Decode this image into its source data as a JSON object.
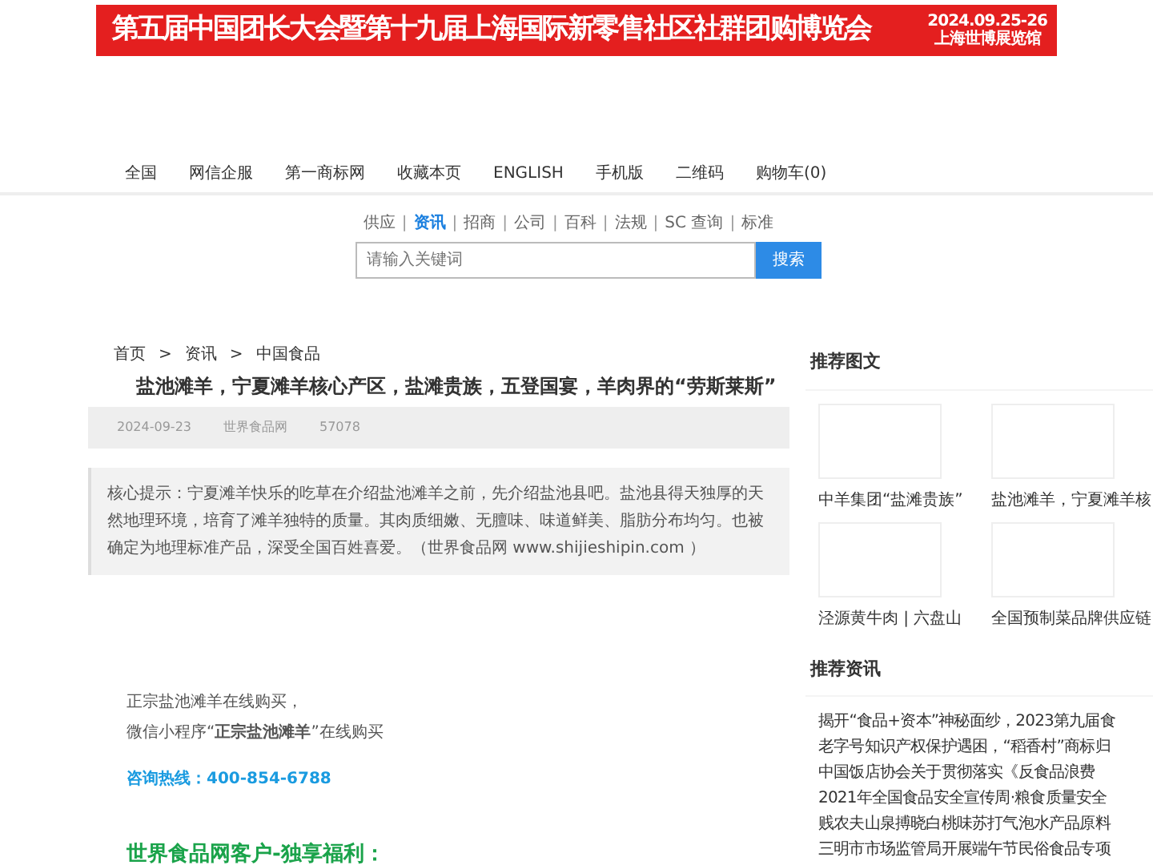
{
  "banner": {
    "title": "第五届中国团长大会暨第十九届上海国际新零售社区社群团购博览会",
    "date": "2024.09.25-26",
    "venue": "上海世博展览馆"
  },
  "top_nav": [
    "全国",
    "网信企服",
    "第一商标网",
    "收藏本页",
    "ENGLISH",
    "手机版",
    "二维码",
    "购物车(0)"
  ],
  "search_tabs": [
    {
      "label": "供应",
      "selected": false
    },
    {
      "label": "资讯",
      "selected": true
    },
    {
      "label": "招商",
      "selected": false
    },
    {
      "label": "公司",
      "selected": false
    },
    {
      "label": "百科",
      "selected": false
    },
    {
      "label": "法规",
      "selected": false
    },
    {
      "label": "SC 查询",
      "selected": false
    },
    {
      "label": "标准",
      "selected": false
    }
  ],
  "search_tab_separator": "|",
  "search": {
    "placeholder": "请输入关键词",
    "button": "搜索"
  },
  "breadcrumb": [
    "首页",
    "资讯",
    "中国食品"
  ],
  "breadcrumb_separator": ">",
  "article": {
    "title": "盐池滩羊，宁夏滩羊核心产区，盐滩贵族，五登国宴，羊肉界的“劳斯莱斯”",
    "date": "2024-09-23",
    "source": "世界食品网",
    "views": "57078",
    "summary": "核心提示：宁夏滩羊快乐的吃草在介绍盐池滩羊之前，先介绍盐池县吧。盐池县得天独厚的天然地理环境，培育了滩羊独特的质量。其肉质细嫩、无膻味、味道鲜美、脂肪分布均匀。也被确定为地理标准产品，深受全国百姓喜爱。（世界食品网 www.shijieshipin.com ）",
    "body": [
      {
        "kind": "plain",
        "text": "正宗盐池滩羊在线购买，"
      },
      {
        "kind": "plain",
        "text": "微信小程序“**正宗盐池滩羊**”在线购买"
      },
      {
        "kind": "hotline",
        "text": "咨询热线：400-854-6788"
      },
      {
        "kind": "heading",
        "text": "世界食品网客户-独享福利："
      }
    ]
  },
  "sidebar": {
    "pictures_title": "推荐图文",
    "pictures": [
      "中羊集团“盐滩贵族”",
      "盐池滩羊，宁夏滩羊核",
      "泾源黄牛肉 | 六盘山",
      "全国预制菜品牌供应链"
    ],
    "news_title": "推荐资讯",
    "news": [
      "揭开“食品+资本”神秘面纱，2023第九届食",
      "老字号知识产权保护遇困，“稻香村”商标归",
      "中国饭店协会关于贯彻落实《反食品浪费",
      "2021年全国食品安全宣传周·粮食质量安全",
      "贱农夫山泉搏晓白桃味苏打气泡水产品原料",
      "三明市市场监管局开展端午节民俗食品专项"
    ]
  }
}
